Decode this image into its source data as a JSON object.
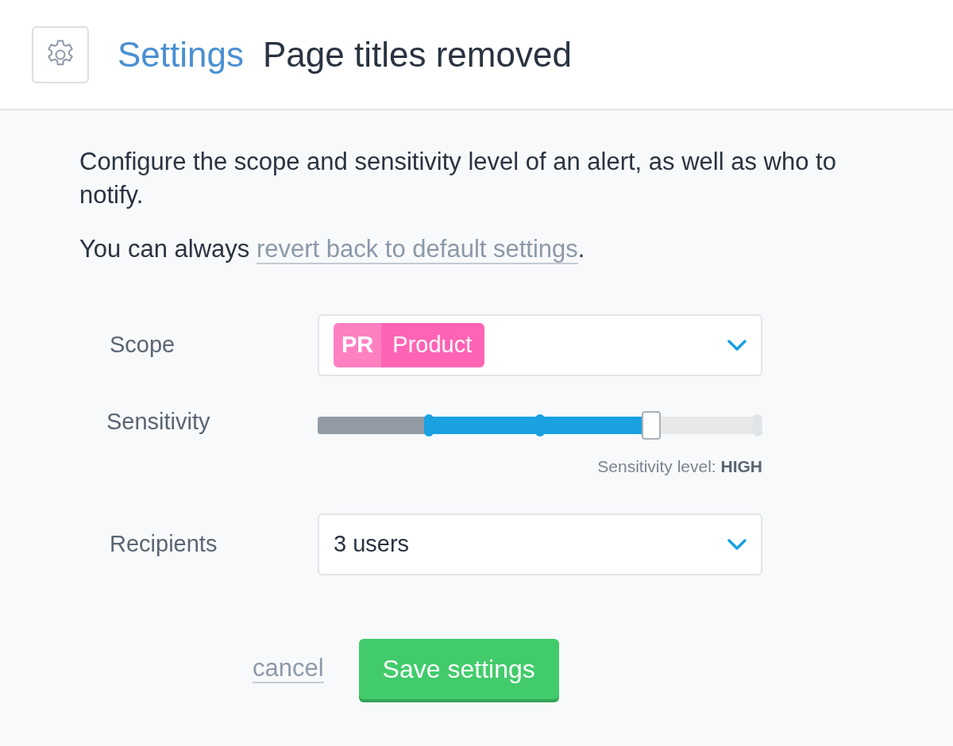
{
  "header": {
    "section": "Settings",
    "title": "Page titles removed"
  },
  "intro": "Configure the scope and sensitivity level of an alert, as well as who to notify.",
  "revert": {
    "before": "You can always ",
    "link": "revert back to default settings",
    "after": "."
  },
  "fields": [
    {
      "kind": "tagselect",
      "label": "Scope",
      "tag": {
        "code": "PR",
        "name": "Product",
        "color": "#ff64b4"
      }
    },
    {
      "kind": "slider",
      "label": "Sensitivity",
      "lower": {
        "level": 0.25
      },
      "level": 0.75,
      "caption": "Sensitivity level: ",
      "value": "HIGH"
    },
    {
      "kind": "select",
      "label": "Recipients",
      "value": "3 users"
    }
  ],
  "actions": {
    "cancel": "cancel",
    "save": "Save settings"
  }
}
